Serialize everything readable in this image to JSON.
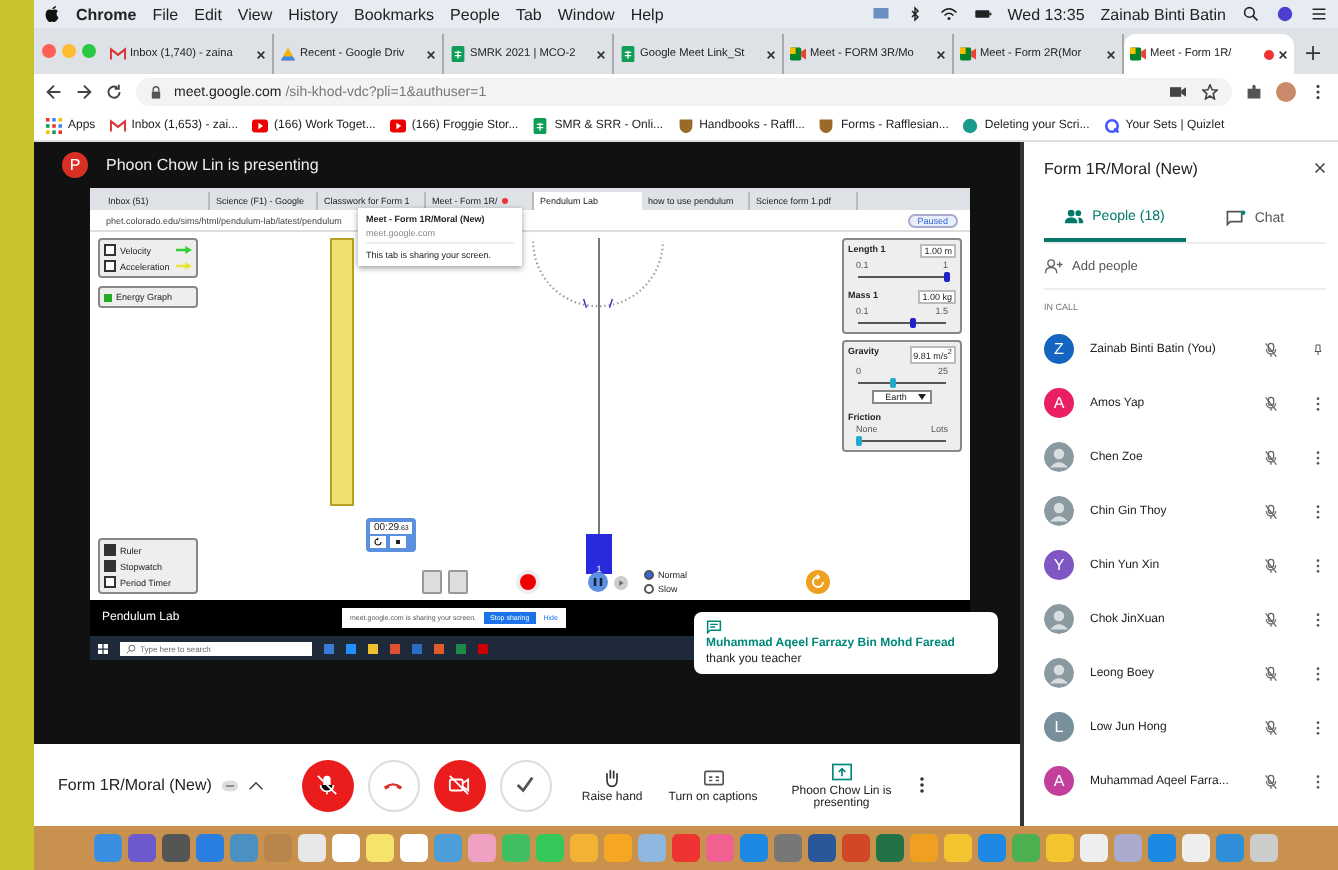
{
  "menubar": {
    "app": "Chrome",
    "menus": [
      "File",
      "Edit",
      "View",
      "History",
      "Bookmarks",
      "People",
      "Tab",
      "Window",
      "Help"
    ],
    "clock": "Wed 13:35",
    "user": "Zainab Binti Batin"
  },
  "tabs": [
    {
      "title": "Inbox (1,740) - zaina",
      "kind": "gmail",
      "selected": false,
      "recording": false
    },
    {
      "title": "Recent - Google Driv",
      "kind": "drive",
      "selected": false,
      "recording": false
    },
    {
      "title": "SMRK 2021 | MCO-2",
      "kind": "sheets",
      "selected": false,
      "recording": false
    },
    {
      "title": "Google Meet Link_St",
      "kind": "sheets",
      "selected": false,
      "recording": false
    },
    {
      "title": "Meet - FORM 3R/Mo",
      "kind": "meet",
      "selected": false,
      "recording": false
    },
    {
      "title": "Meet - Form 2R(Mor",
      "kind": "meet",
      "selected": false,
      "recording": false
    },
    {
      "title": "Meet - Form 1R/",
      "kind": "meet",
      "selected": true,
      "recording": true
    }
  ],
  "url": {
    "host": "meet.google.com",
    "path": "/sih-khod-vdc?pli=1&authuser=1"
  },
  "bookmarks": [
    {
      "label": "Apps",
      "kind": "apps"
    },
    {
      "label": "Inbox (1,653) - zai...",
      "kind": "gmail"
    },
    {
      "label": "(166) Work Toget...",
      "kind": "youtube"
    },
    {
      "label": "(166) Froggie Stor...",
      "kind": "youtube"
    },
    {
      "label": "SMR & SRR - Onli...",
      "kind": "sheets"
    },
    {
      "label": "Handbooks - Raffl...",
      "kind": "crest"
    },
    {
      "label": "Forms - Rafflesian...",
      "kind": "crest"
    },
    {
      "label": "Deleting your Scri...",
      "kind": "circle"
    },
    {
      "label": "Your Sets | Quizlet",
      "kind": "quizlet"
    }
  ],
  "presenter": {
    "initial": "P",
    "text": "Phoon Chow Lin is presenting"
  },
  "shared_screen": {
    "tabs": [
      {
        "title": "Inbox (51)",
        "selected": false,
        "recording": false
      },
      {
        "title": "Science (F1) - Google",
        "selected": false,
        "recording": false
      },
      {
        "title": "Classwork for Form 1",
        "selected": false,
        "recording": false
      },
      {
        "title": "Meet - Form 1R/",
        "selected": false,
        "recording": true
      },
      {
        "title": "Pendulum Lab",
        "selected": true,
        "recording": false
      },
      {
        "title": "how to use pendulum",
        "selected": false,
        "recording": false
      },
      {
        "title": "Science form 1.pdf",
        "selected": false,
        "recording": false
      }
    ],
    "url": "phet.colorado.edu/sims/html/pendulum-lab/latest/pendulum",
    "profile": "Paused",
    "tooltip": {
      "title": "Meet - Form 1R/Moral (New)",
      "host": "meet.google.com",
      "note": "This tab is sharing your screen."
    },
    "vectors": [
      {
        "label": "Velocity",
        "checked": false,
        "color": "#33cc33"
      },
      {
        "label": "Acceleration",
        "checked": false,
        "color": "#e6e633"
      }
    ],
    "energy": "Energy Graph",
    "sliders": [
      {
        "label": "Length 1",
        "value": "1.00 m",
        "min": "0.1",
        "max": "1",
        "level": 1.0
      },
      {
        "label": "Mass 1",
        "value": "1.00 kg",
        "min": "0.1",
        "max": "1.5",
        "level": 0.62
      }
    ],
    "gravity": {
      "label": "Gravity",
      "value": "9.81 m/s$^{2}$",
      "min": "0",
      "max": "25",
      "level": 0.39,
      "planet": "Earth"
    },
    "friction": {
      "label": "Friction",
      "min": "None",
      "max": "Lots",
      "level": 0
    },
    "stopwatch": {
      "time": "00:29",
      "hundredths": ".63"
    },
    "mass_label": "1",
    "tools": [
      {
        "label": "Ruler",
        "checked": true
      },
      {
        "label": "Stopwatch",
        "checked": true
      },
      {
        "label": "Period Timer",
        "checked": false
      }
    ],
    "playing": true,
    "speeds": [
      {
        "label": "Normal",
        "selected": true
      },
      {
        "label": "Slow",
        "selected": false
      }
    ],
    "title": "Pendulum Lab",
    "share_bar": {
      "text": "meet.google.com is sharing your screen.",
      "stop": "Stop sharing",
      "hide": "Hide"
    },
    "taskbar": {
      "search": "Type here to search"
    }
  },
  "chat_toast": {
    "sender": "Muhammad Aqeel Farrazy Bin Mohd Faread",
    "message": "thank you teacher"
  },
  "call_bar": {
    "meeting": "Form 1R/Moral (New)",
    "controls": [
      {
        "kind": "mic-off"
      },
      {
        "kind": "hangup"
      },
      {
        "kind": "cam-off"
      },
      {
        "kind": "check"
      }
    ],
    "actions": [
      {
        "label": "Raise hand",
        "kind": "hand"
      },
      {
        "label": "Turn on captions",
        "kind": "captions"
      },
      {
        "label": "Phoon Chow Lin is presenting",
        "kind": "present"
      }
    ]
  },
  "panel": {
    "title": "Form 1R/Moral (New)",
    "tabs": [
      {
        "label": "People (18)",
        "kind": "people",
        "selected": true
      },
      {
        "label": "Chat",
        "kind": "chat",
        "selected": false
      }
    ],
    "add": "Add people",
    "section": "IN CALL",
    "people": [
      {
        "name": "Zainab Binti Batin (You)",
        "kind": "letter",
        "initial": "Z",
        "color": "#1565c0",
        "pinned": true
      },
      {
        "name": "Amos Yap",
        "kind": "letter",
        "initial": "A",
        "color": "#e91e63",
        "pinned": false
      },
      {
        "name": "Chen Zoe",
        "kind": "photo",
        "pinned": false
      },
      {
        "name": "Chin Gin Thoy",
        "kind": "photo",
        "pinned": false
      },
      {
        "name": "Chin Yun Xin",
        "kind": "letter",
        "initial": "Y",
        "color": "#7e57c2",
        "pinned": false
      },
      {
        "name": "Chok JinXuan",
        "kind": "photo",
        "pinned": false
      },
      {
        "name": "Leong Boey",
        "kind": "photo",
        "pinned": false
      },
      {
        "name": "Low Jun Hong",
        "kind": "letter",
        "initial": "L",
        "color": "#78909c",
        "pinned": false
      },
      {
        "name": "Muhammad Aqeel Farra...",
        "kind": "letter",
        "initial": "A",
        "color": "#c2409c",
        "pinned": false
      }
    ]
  }
}
